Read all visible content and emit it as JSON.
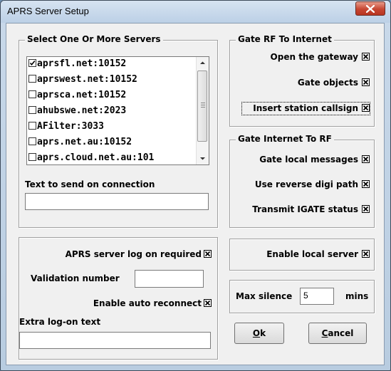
{
  "window": {
    "title": "APRS Server Setup"
  },
  "servers": {
    "legend": "Select One Or More Servers",
    "items": [
      {
        "label": "aprsfl.net:10152",
        "checked": true
      },
      {
        "label": "aprswest.net:10152",
        "checked": false
      },
      {
        "label": "aprsca.net:10152",
        "checked": false
      },
      {
        "label": "ahubswe.net:2023",
        "checked": false
      },
      {
        "label": "AFilter:3033",
        "checked": false
      },
      {
        "label": "aprs.net.au:10152",
        "checked": false
      },
      {
        "label": "aprs.cloud.net.au:101",
        "checked": false
      }
    ],
    "connect_text_label": "Text to send on connection",
    "connect_text_value": ""
  },
  "gate_rf": {
    "legend": "Gate RF To Internet",
    "open_gateway": {
      "label": "Open the gateway",
      "checked": true
    },
    "gate_objects": {
      "label": "Gate objects",
      "checked": true
    },
    "insert_callsign": {
      "label": "Insert station callsign",
      "checked": true
    }
  },
  "gate_inet": {
    "legend": "Gate Internet To RF",
    "local_messages": {
      "label": "Gate local messages",
      "checked": true
    },
    "reverse_digi": {
      "label": "Use reverse digi path",
      "checked": true
    },
    "igate_status": {
      "label": "Transmit IGATE status",
      "checked": true
    }
  },
  "logon": {
    "logon_required": {
      "label": "APRS server log on required",
      "checked": true
    },
    "validation_label": "Validation number",
    "validation_value": "",
    "auto_reconnect": {
      "label": "Enable auto reconnect",
      "checked": true
    },
    "extra_label": "Extra log-on text",
    "extra_value": ""
  },
  "local_server": {
    "label": "Enable local server",
    "checked": true
  },
  "silence": {
    "label": "Max silence",
    "value": "5",
    "unit": "mins"
  },
  "buttons": {
    "ok_mnemonic": "O",
    "ok_rest": "k",
    "cancel_mnemonic": "C",
    "cancel_rest": "ancel"
  }
}
